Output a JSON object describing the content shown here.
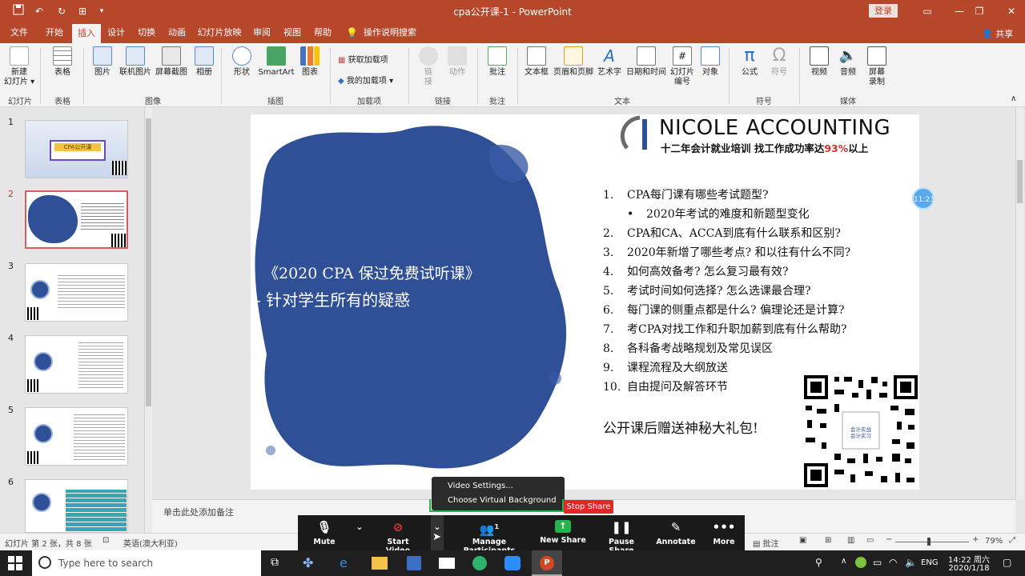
{
  "window": {
    "title": "cpa公开课-1  -  PowerPoint",
    "login": "登录",
    "share": "共享"
  },
  "menu": {
    "items": [
      "文件",
      "开始",
      "插入",
      "设计",
      "切换",
      "动画",
      "幻灯片放映",
      "审阅",
      "视图",
      "帮助",
      "操作说明搜索"
    ],
    "active": "插入"
  },
  "ribbon": {
    "buttons": {
      "new_slide": "新建\n幻灯片 ▾",
      "table": "表格",
      "picture": "图片",
      "online_picture": "联机图片",
      "screenshot": "屏幕截图",
      "album": "相册",
      "shapes": "形状",
      "smartart": "SmartArt",
      "chart": "图表",
      "get_addins": "获取加载项",
      "my_addins": "我的加载项",
      "link": "链\n接",
      "action": "动作",
      "comment": "批注",
      "textbox": "文本框",
      "header_footer": "页眉和页脚",
      "wordart": "艺术字",
      "datetime": "日期和时间",
      "slide_number": "幻灯片\n编号",
      "object": "对象",
      "equation": "公式",
      "symbol": "符号",
      "video": "视频",
      "audio": "音频",
      "screen_recording": "屏幕\n录制"
    },
    "groups": {
      "slides": "幻灯片",
      "tables": "表格",
      "images": "图像",
      "illustrations": "插图",
      "addins": "加载项",
      "links": "链接",
      "comments": "批注",
      "text": "文本",
      "symbols": "符号",
      "media": "媒体"
    }
  },
  "thumbnails": [
    {
      "num": "1",
      "caption": "CPA公开课"
    },
    {
      "num": "2",
      "caption": ""
    },
    {
      "num": "3",
      "caption": ""
    },
    {
      "num": "4",
      "caption": ""
    },
    {
      "num": "5",
      "caption": ""
    },
    {
      "num": "6",
      "caption": ""
    }
  ],
  "slide": {
    "logo_text": "NICOLE ACCOUNTING",
    "logo_sub_prefix": "十二年会计就业培训  找工作成功率达",
    "logo_sub_pct": "93%",
    "logo_sub_suffix": "以上",
    "left_title_1": "《2020 CPA 保过免费试听课》",
    "left_title_2": "- 针对学生所有的疑惑",
    "questions": [
      {
        "n": "1.",
        "t": "CPA每门课有哪些考试题型?"
      },
      {
        "n": "•",
        "t": "2020年考试的难度和新题型变化"
      },
      {
        "n": "2.",
        "t": "CPA和CA、ACCA到底有什么联系和区别?"
      },
      {
        "n": "3.",
        "t": "2020年新增了哪些考点? 和以往有什么不同?"
      },
      {
        "n": "4.",
        "t": "如何高效备考? 怎么复习最有效?"
      },
      {
        "n": "5.",
        "t": "考试时间如何选择? 怎么选课最合理?"
      },
      {
        "n": "6.",
        "t": "每门课的侧重点都是什么? 偏理论还是计算?"
      },
      {
        "n": "7.",
        "t": "考CPA对找工作和升职加薪到底有什么帮助?"
      },
      {
        "n": "8.",
        "t": "各科备考战略规划及常见误区"
      },
      {
        "n": "9.",
        "t": "课程流程及大纲放送"
      },
      {
        "n": "10.",
        "t": "自由提问及解答环节"
      }
    ],
    "gift": "公开课后赠送神秘大礼包!",
    "qr_label": "会计实战\n会计实习"
  },
  "timer_badge": "11:23",
  "notes_placeholder": "单击此处添加备注",
  "status": {
    "slide_info": "幻灯片 第 2 张，共 8 张",
    "language": "英语(澳大利亚)",
    "comments": "批注",
    "zoom": "79%"
  },
  "zoom": {
    "mute": "Mute",
    "start_video": "Start Video",
    "manage_participants": "Manage Participants",
    "participants_count": "1",
    "new_share": "New Share",
    "pause_share": "Pause Share",
    "annotate": "Annotate",
    "more": "More",
    "popup": [
      "Video Settings...",
      "Choose Virtual Background"
    ],
    "stop_share": "Stop Share"
  },
  "taskbar": {
    "search_placeholder": "Type here to search",
    "time": "14:22 周六",
    "date": "2020/1/18",
    "lang": "ENG"
  },
  "colors": {
    "accent": "#b7472a",
    "slide_blue": "#2f4f96",
    "zoom_green": "#23b54d",
    "stop_red": "#e02828"
  }
}
